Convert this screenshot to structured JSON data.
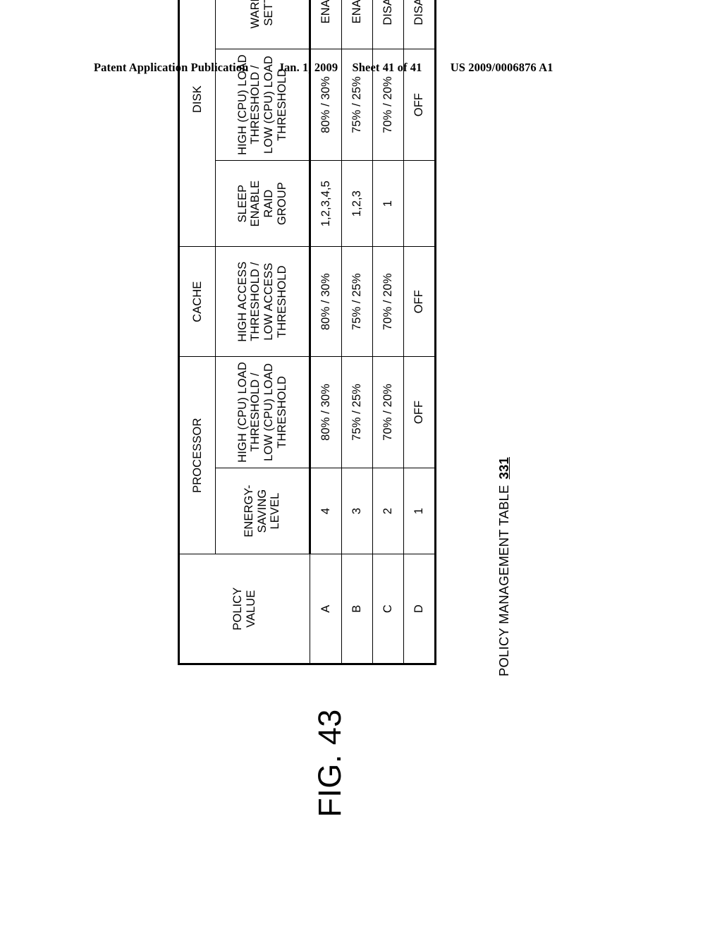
{
  "page_header": {
    "publication": "Patent Application Publication",
    "date": "Jan. 1, 2009",
    "sheet": "Sheet 41 of 41",
    "patent_number": "US 2009/0006876 A1"
  },
  "figure": {
    "label": "FIG. 43",
    "caption": "POLICY MANAGEMENT TABLE",
    "reference_numeral": "331"
  },
  "table": {
    "group_headers": {
      "policy_value": "POLICY\nVALUE",
      "processor": "PROCESSOR",
      "cache": "CACHE",
      "disk": "DISK"
    },
    "sub_headers": {
      "policy_value": "POLICY VALUE",
      "energy_saving_level": "ENERGY-\nSAVING\nLEVEL",
      "processor_threshold": "HIGH (CPU) LOAD\nTHRESHOLD /\nLOW (CPU) LOAD\nTHRESHOLD",
      "cache_threshold": "HIGH ACCESS\nTHRESHOLD /\nLOW ACCESS\nTHRESHOLD",
      "sleep_enable_raid_group": "SLEEP\nENABLE\nRAID\nGROUP",
      "disk_threshold": "HIGH (CPU) LOAD\nTHRESHOLD /\nLOW (CPU) LOAD\nTHRESHOLD",
      "warning_setting": "WARNING\nSETTING"
    },
    "sub_header_lines": {
      "policy_value": [
        "POLICY",
        "VALUE"
      ],
      "energy_saving_level": [
        "ENERGY-",
        "SAVING",
        "LEVEL"
      ],
      "processor_threshold": [
        "HIGH (CPU) LOAD",
        "THRESHOLD /",
        "LOW (CPU) LOAD",
        "THRESHOLD"
      ],
      "cache_threshold": [
        "HIGH ACCESS",
        "THRESHOLD /",
        "LOW ACCESS",
        "THRESHOLD"
      ],
      "sleep_enable_raid_group": [
        "SLEEP",
        "ENABLE",
        "RAID",
        "GROUP"
      ],
      "disk_threshold": [
        "HIGH (CPU) LOAD",
        "THRESHOLD /",
        "LOW (CPU) LOAD",
        "THRESHOLD"
      ],
      "warning_setting": [
        "WARNING",
        "SETTING"
      ]
    },
    "rows": [
      {
        "policy_value": "A",
        "energy_saving_level": "4",
        "processor_threshold": "80% / 30%",
        "cache_threshold": "80% / 30%",
        "sleep_enable_raid_group": "1,2,3,4,5",
        "disk_threshold": "80% / 30%",
        "warning_setting": "ENABLE"
      },
      {
        "policy_value": "B",
        "energy_saving_level": "3",
        "processor_threshold": "75% / 25%",
        "cache_threshold": "75% / 25%",
        "sleep_enable_raid_group": "1,2,3",
        "disk_threshold": "75% / 25%",
        "warning_setting": "ENABLE"
      },
      {
        "policy_value": "C",
        "energy_saving_level": "2",
        "processor_threshold": "70% / 20%",
        "cache_threshold": "70% / 20%",
        "sleep_enable_raid_group": "1",
        "disk_threshold": "70% / 20%",
        "warning_setting": "DISABLE"
      },
      {
        "policy_value": "D",
        "energy_saving_level": "1",
        "processor_threshold": "OFF",
        "cache_threshold": "OFF",
        "sleep_enable_raid_group": "",
        "disk_threshold": "OFF",
        "warning_setting": "DISABLE"
      }
    ]
  }
}
